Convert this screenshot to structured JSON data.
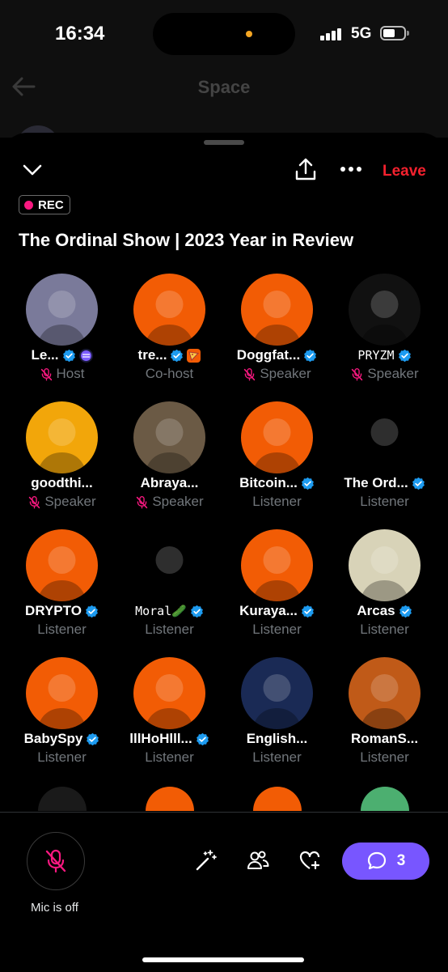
{
  "status_bar": {
    "time": "16:34",
    "network": "5G"
  },
  "background_header": {
    "title": "Space"
  },
  "sheet": {
    "leave_label": "Leave",
    "rec_label": "REC",
    "title": "The Ordinal Show | 2023 Year in Review"
  },
  "participants": [
    {
      "name": "Le...",
      "role": "Host",
      "verified": true,
      "muted": true,
      "extra_badge": "badge",
      "avatar_color": "#7a7a9a"
    },
    {
      "name": "tre...",
      "role": "Co-host",
      "verified": true,
      "muted": false,
      "extra_badge": "pizza",
      "avatar_color": "#f25c05"
    },
    {
      "name": "Doggfat...",
      "role": "Speaker",
      "verified": true,
      "muted": true,
      "avatar_color": "#f25c05"
    },
    {
      "name": "PRYZM",
      "role": "Speaker",
      "verified": true,
      "muted": true,
      "mono": true,
      "avatar_color": "#111111"
    },
    {
      "name": "goodthi...",
      "role": "Speaker",
      "verified": false,
      "muted": true,
      "avatar_color": "#f2a60a"
    },
    {
      "name": "Abraya...",
      "role": "Speaker",
      "verified": false,
      "muted": true,
      "avatar_color": "#6b5a45"
    },
    {
      "name": "Bitcoin...",
      "role": "Listener",
      "verified": true,
      "muted": false,
      "avatar_color": "#f25c05"
    },
    {
      "name": "The Ord...",
      "role": "Listener",
      "verified": true,
      "muted": false,
      "avatar_color": "#000000"
    },
    {
      "name": "DRYPTO",
      "role": "Listener",
      "verified": true,
      "muted": false,
      "avatar_color": "#f25c05"
    },
    {
      "name": "Moral🥒",
      "role": "Listener",
      "verified": true,
      "muted": false,
      "mono": true,
      "avatar_color": "#000000"
    },
    {
      "name": "Kuraya...",
      "role": "Listener",
      "verified": true,
      "muted": false,
      "avatar_color": "#f25c05"
    },
    {
      "name": "Arcas",
      "role": "Listener",
      "verified": true,
      "muted": false,
      "avatar_color": "#d8d3b8"
    },
    {
      "name": "BabySpy",
      "role": "Listener",
      "verified": true,
      "muted": false,
      "avatar_color": "#f25c05"
    },
    {
      "name": "lllHoHlll...",
      "role": "Listener",
      "verified": true,
      "muted": false,
      "avatar_color": "#f25c05"
    },
    {
      "name": "English...",
      "role": "Listener",
      "verified": false,
      "muted": false,
      "avatar_color": "#1a2a55"
    },
    {
      "name": "RomanS...",
      "role": "Listener",
      "verified": false,
      "muted": false,
      "avatar_color": "#c05a18"
    }
  ],
  "bottom_bar": {
    "mic_label": "Mic is off",
    "chat_count": "3"
  },
  "colors": {
    "accent": "#7856ff",
    "leave": "#f4212e",
    "verified": "#1d9bf0",
    "rec_dot": "#f91880",
    "mic_off": "#f91880"
  }
}
